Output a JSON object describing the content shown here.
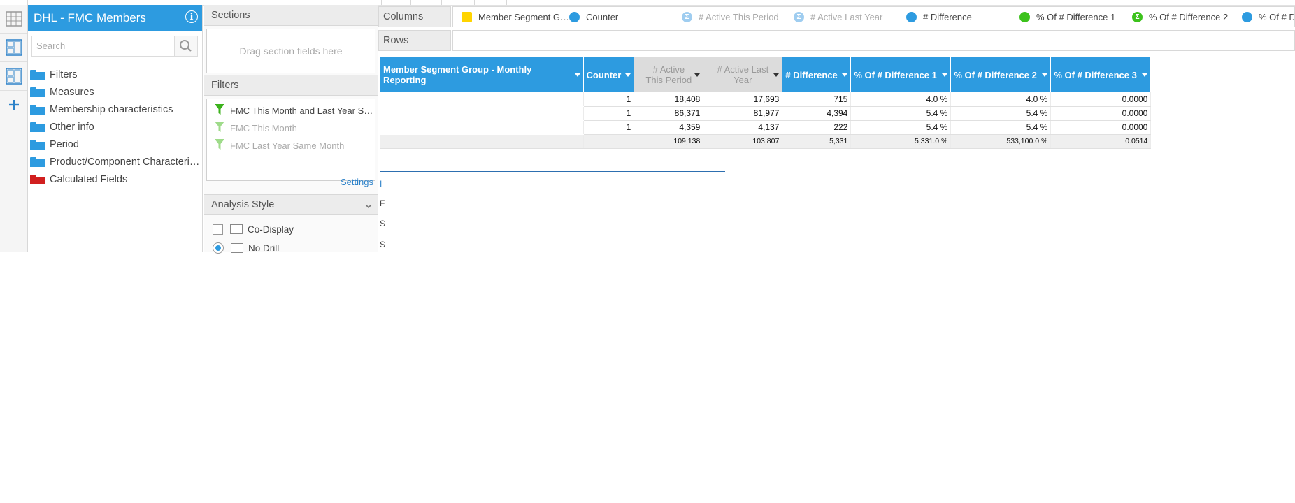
{
  "datasource": {
    "title": "DHL - FMC Members",
    "info_glyph": "i"
  },
  "search": {
    "placeholder": "Search"
  },
  "tree": [
    {
      "label": "Filters",
      "color": "#2d9be0"
    },
    {
      "label": "Measures",
      "color": "#2d9be0"
    },
    {
      "label": "Membership characteristics",
      "color": "#2d9be0"
    },
    {
      "label": "Other info",
      "color": "#2d9be0"
    },
    {
      "label": "Period",
      "color": "#2d9be0"
    },
    {
      "label": "Product/Component Characteri…",
      "color": "#2d9be0"
    },
    {
      "label": "Calculated Fields",
      "color": "#d11f1f"
    }
  ],
  "sections": {
    "header": "Sections",
    "placeholder": "Drag section fields here"
  },
  "filters": {
    "header": "Filters",
    "items": [
      {
        "label": "FMC This Month and Last Year S…",
        "active": true
      },
      {
        "label": "FMC This Month",
        "active": false
      },
      {
        "label": "FMC Last Year Same Month",
        "active": false
      }
    ],
    "settings_label": "Settings"
  },
  "analysis_style": {
    "header": "Analysis Style",
    "options": [
      {
        "label": "Co-Display",
        "type": "checkbox"
      },
      {
        "label": "No Drill",
        "type": "radio"
      }
    ]
  },
  "columns_shelf": {
    "label": "Columns",
    "chips": [
      {
        "label": "Member Segment G…",
        "icon": "square",
        "color": "#ffd400",
        "muted": false
      },
      {
        "label": "Counter",
        "icon": "circle",
        "color": "#2d9be0",
        "muted": false
      },
      {
        "label": "# Active This Period",
        "icon": "sigma",
        "color": "#9fcdf0",
        "muted": true
      },
      {
        "label": "# Active Last Year",
        "icon": "sigma",
        "color": "#9fcdf0",
        "muted": true
      },
      {
        "label": "# Difference",
        "icon": "circle",
        "color": "#2d9be0",
        "muted": false
      },
      {
        "label": "% Of # Difference 1",
        "icon": "circle",
        "color": "#3cc21c",
        "muted": false
      },
      {
        "label": "% Of # Difference 2",
        "icon": "sigma",
        "color": "#3cc21c",
        "muted": false
      },
      {
        "label": "% Of # Di",
        "icon": "circle",
        "color": "#2d9be0",
        "muted": false
      }
    ]
  },
  "rows_shelf": {
    "label": "Rows"
  },
  "report": {
    "headers": [
      {
        "label": "Member Segment Group - Monthly Reporting",
        "dim": false
      },
      {
        "label": "Counter",
        "dim": false
      },
      {
        "label": "# Active This Period",
        "dim": true
      },
      {
        "label": "# Active Last Year",
        "dim": true
      },
      {
        "label": "# Difference",
        "dim": false
      },
      {
        "label": "% Of # Difference 1",
        "dim": false
      },
      {
        "label": "% Of # Difference 2",
        "dim": false
      },
      {
        "label": "% Of # Difference 3",
        "dim": false
      }
    ],
    "rows": [
      [
        "",
        "1",
        "18,408",
        "17,693",
        "715",
        "4.0 %",
        "4.0 %",
        "0.0000"
      ],
      [
        "",
        "1",
        "86,371",
        "81,977",
        "4,394",
        "5.4 %",
        "5.4 %",
        "0.0000"
      ],
      [
        "",
        "1",
        "4,359",
        "4,137",
        "222",
        "5.4 %",
        "5.4 %",
        "0.0000"
      ]
    ],
    "total": [
      "",
      "",
      "109,138",
      "103,807",
      "5,331",
      "5,331.0 %",
      "533,100.0 %",
      "0.0514"
    ]
  },
  "below_table_stubs": [
    "I",
    "F",
    "S",
    "S"
  ]
}
